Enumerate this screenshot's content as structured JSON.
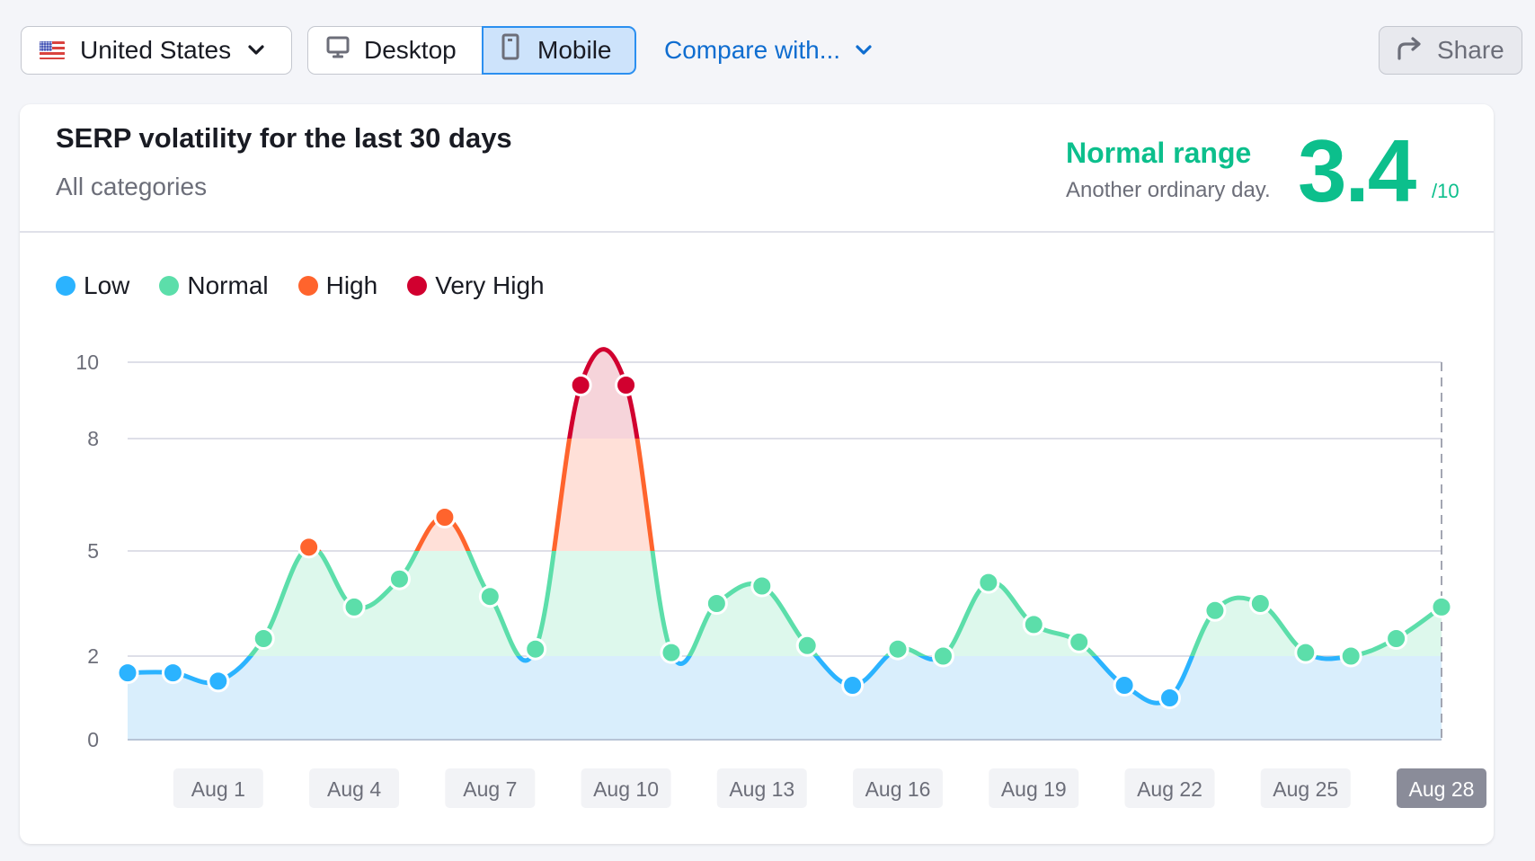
{
  "toolbar": {
    "country": {
      "label": "United States",
      "icon": "us-flag-icon"
    },
    "device_toggle": {
      "options": [
        {
          "label": "Desktop",
          "icon": "desktop-icon",
          "selected": false
        },
        {
          "label": "Mobile",
          "icon": "mobile-icon",
          "selected": true
        }
      ]
    },
    "compare": {
      "label": "Compare with..."
    },
    "share": {
      "label": "Share",
      "icon": "share-arrow-icon"
    }
  },
  "card": {
    "title": "SERP volatility for the last 30 days",
    "subtitle": "All categories",
    "status_label": "Normal range",
    "status_description": "Another ordinary day.",
    "score": "3.4",
    "score_max": "/10"
  },
  "colors": {
    "low": "#2bb3ff",
    "normal": "#5cdeaa",
    "high": "#ff642d",
    "very_high": "#d1002f",
    "accent": "#0cbf8c",
    "link": "#0f6dd0"
  },
  "chart_data": {
    "type": "area",
    "title": "SERP volatility for the last 30 days",
    "xlabel": "",
    "ylabel": "",
    "ylim": [
      0,
      10
    ],
    "yticks": [
      0,
      2,
      5,
      8,
      10
    ],
    "grid": true,
    "legend_position": "top-left",
    "legend": [
      {
        "name": "Low",
        "color": "#2bb3ff",
        "range": [
          0,
          2
        ]
      },
      {
        "name": "Normal",
        "color": "#5cdeaa",
        "range": [
          2,
          5
        ]
      },
      {
        "name": "High",
        "color": "#ff642d",
        "range": [
          5,
          8
        ]
      },
      {
        "name": "Very High",
        "color": "#d1002f",
        "range": [
          8,
          10
        ]
      }
    ],
    "x": [
      "Jul 30",
      "Jul 31",
      "Aug 1",
      "Aug 2",
      "Aug 3",
      "Aug 4",
      "Aug 5",
      "Aug 6",
      "Aug 7",
      "Aug 8",
      "Aug 9",
      "Aug 10",
      "Aug 11",
      "Aug 12",
      "Aug 13",
      "Aug 14",
      "Aug 15",
      "Aug 16",
      "Aug 17",
      "Aug 18",
      "Aug 19",
      "Aug 20",
      "Aug 21",
      "Aug 22",
      "Aug 23",
      "Aug 24",
      "Aug 25",
      "Aug 26",
      "Aug 27",
      "Aug 28"
    ],
    "xtick_labels": [
      "Aug 1",
      "Aug 4",
      "Aug 7",
      "Aug 10",
      "Aug 13",
      "Aug 16",
      "Aug 19",
      "Aug 22",
      "Aug 25",
      "Aug 28"
    ],
    "highlighted_x": "Aug 28",
    "series": [
      {
        "name": "Volatility",
        "values": [
          1.6,
          1.6,
          1.4,
          2.5,
          5.1,
          3.4,
          4.2,
          5.9,
          3.7,
          2.2,
          9.4,
          9.4,
          2.1,
          3.5,
          4.0,
          2.3,
          1.3,
          2.2,
          2.0,
          4.1,
          2.9,
          2.4,
          1.3,
          1.0,
          3.3,
          3.5,
          2.1,
          2.0,
          2.5,
          3.4
        ]
      }
    ]
  }
}
